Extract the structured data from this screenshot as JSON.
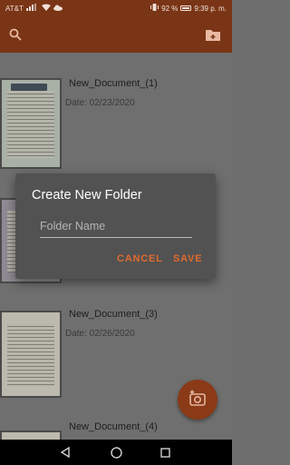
{
  "status_bar": {
    "carrier": "AT&T",
    "battery_percent": "92 %",
    "time": "9:39 p. m."
  },
  "app_bar": {
    "icons": [
      "search-icon",
      "add-folder-icon"
    ]
  },
  "documents": [
    {
      "name": "New_Document_(1)",
      "date": "Date: 02/23/2020"
    },
    {
      "name": "New_Document_(3)",
      "date": "Date: 02/26/2020"
    },
    {
      "name": "New_Document_(4)",
      "date": ""
    }
  ],
  "dialog": {
    "title": "Create New Folder",
    "input_placeholder": "Folder Name",
    "input_value": "",
    "cancel_label": "CANCEL",
    "save_label": "SAVE",
    "accent_color": "#e06a2e"
  },
  "fab": {
    "icon": "add-photo-icon"
  },
  "nav_bar": {
    "icons": [
      "back-icon",
      "home-icon",
      "recents-icon"
    ]
  },
  "colors": {
    "app_bar": "#7a3516",
    "scrim": "#6f6f6f",
    "dialog": "#525252"
  }
}
